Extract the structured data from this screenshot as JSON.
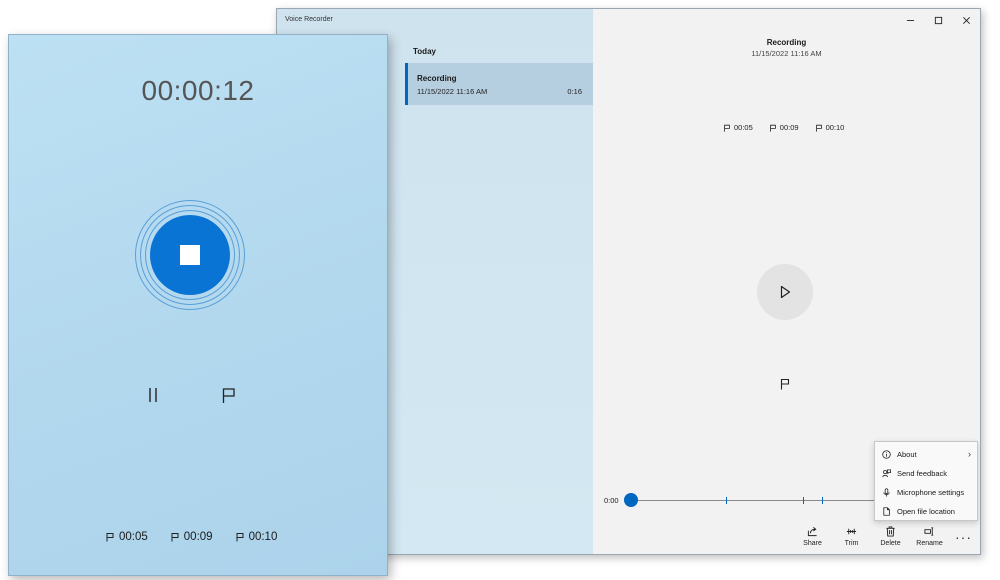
{
  "back_window": {
    "title": "Voice Recorder",
    "caption_buttons": [
      "minimize-icon",
      "maximize-icon",
      "close-icon"
    ],
    "list": {
      "group_label": "Today",
      "items": [
        {
          "name": "Recording",
          "date": "11/15/2022 11:16 AM",
          "duration": "0:16"
        }
      ]
    },
    "detail": {
      "title": "Recording",
      "date": "11/15/2022 11:16 AM",
      "markers": [
        "00:05",
        "00:09",
        "00:10"
      ],
      "timeline_start": "0:00"
    },
    "toolbar": {
      "share": "Share",
      "trim": "Trim",
      "delete": "Delete",
      "rename": "Rename",
      "more": "···"
    },
    "context_menu": {
      "about": "About",
      "send_feedback": "Send feedback",
      "microphone_settings": "Microphone settings",
      "open_file_location": "Open file location"
    }
  },
  "recording_window": {
    "timer": "00:00:12",
    "markers": [
      "00:05",
      "00:09",
      "00:10"
    ]
  },
  "colors": {
    "accent": "#0a74d4",
    "sidebar_bg": "#cfe3ef",
    "recording_bg": "#b6dcf0"
  }
}
